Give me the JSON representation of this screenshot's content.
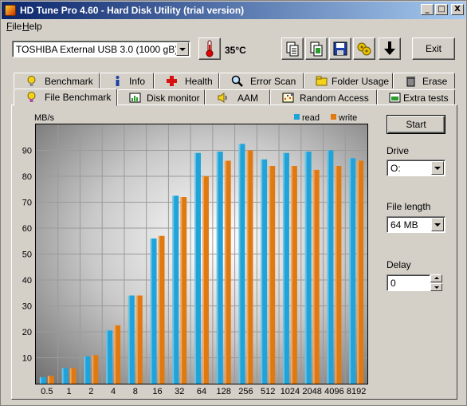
{
  "window": {
    "title": "HD Tune Pro 4.60 - Hard Disk Utility (trial version)",
    "controls": {
      "minimize": "_",
      "maximize": "□",
      "close": "X"
    }
  },
  "menu": [
    {
      "label": "File",
      "mnemonic": "F"
    },
    {
      "label": "Help",
      "mnemonic": "H"
    }
  ],
  "toolbar": {
    "drive": "TOSHIBA External USB 3.0 (1000 gB)",
    "temperature": "35°C",
    "exit_label": "Exit",
    "icons": [
      "copy-text-icon",
      "copy-screenshot-icon",
      "save-icon",
      "options-icon",
      "download-icon"
    ]
  },
  "tabs_row1": [
    {
      "label": "Benchmark",
      "icon": "benchmark-icon"
    },
    {
      "label": "Info",
      "icon": "info-icon"
    },
    {
      "label": "Health",
      "icon": "health-icon"
    },
    {
      "label": "Error Scan",
      "icon": "error-scan-icon"
    },
    {
      "label": "Folder Usage",
      "icon": "folder-icon"
    },
    {
      "label": "Erase",
      "icon": "erase-icon"
    }
  ],
  "tabs_row2": [
    {
      "label": "File Benchmark",
      "icon": "file-benchmark-icon",
      "active": true
    },
    {
      "label": "Disk monitor",
      "icon": "disk-monitor-icon"
    },
    {
      "label": "AAM",
      "icon": "speaker-icon"
    },
    {
      "label": "Random Access",
      "icon": "random-access-icon"
    },
    {
      "label": "Extra tests",
      "icon": "extra-tests-icon"
    }
  ],
  "side": {
    "start_label": "Start",
    "drive_label": "Drive",
    "drive_value": "O:",
    "file_length_label": "File length",
    "file_length_value": "64 MB",
    "delay_label": "Delay",
    "delay_value": "0"
  },
  "colors": {
    "read": "#1fa3d8",
    "write": "#e07a10"
  },
  "chart_data": {
    "type": "bar",
    "title": "",
    "xlabel": "",
    "ylabel": "MB/s",
    "ylim": [
      0,
      100
    ],
    "yticks": [
      10,
      20,
      30,
      40,
      50,
      60,
      70,
      80,
      90
    ],
    "grid": true,
    "legend_position": "top-right",
    "categories": [
      "0.5",
      "1",
      "2",
      "4",
      "8",
      "16",
      "32",
      "64",
      "128",
      "256",
      "512",
      "1024",
      "2048",
      "4096",
      "8192"
    ],
    "series": [
      {
        "name": "read",
        "values": [
          2.5,
          6,
          10.5,
          20.5,
          34,
          56,
          72.5,
          89,
          89.5,
          92.5,
          86.5,
          89,
          89.5,
          90,
          87
        ]
      },
      {
        "name": "write",
        "values": [
          3,
          6,
          11,
          22.5,
          34,
          57,
          72,
          80,
          86,
          90,
          84,
          84,
          82.5,
          84,
          86
        ]
      }
    ]
  }
}
